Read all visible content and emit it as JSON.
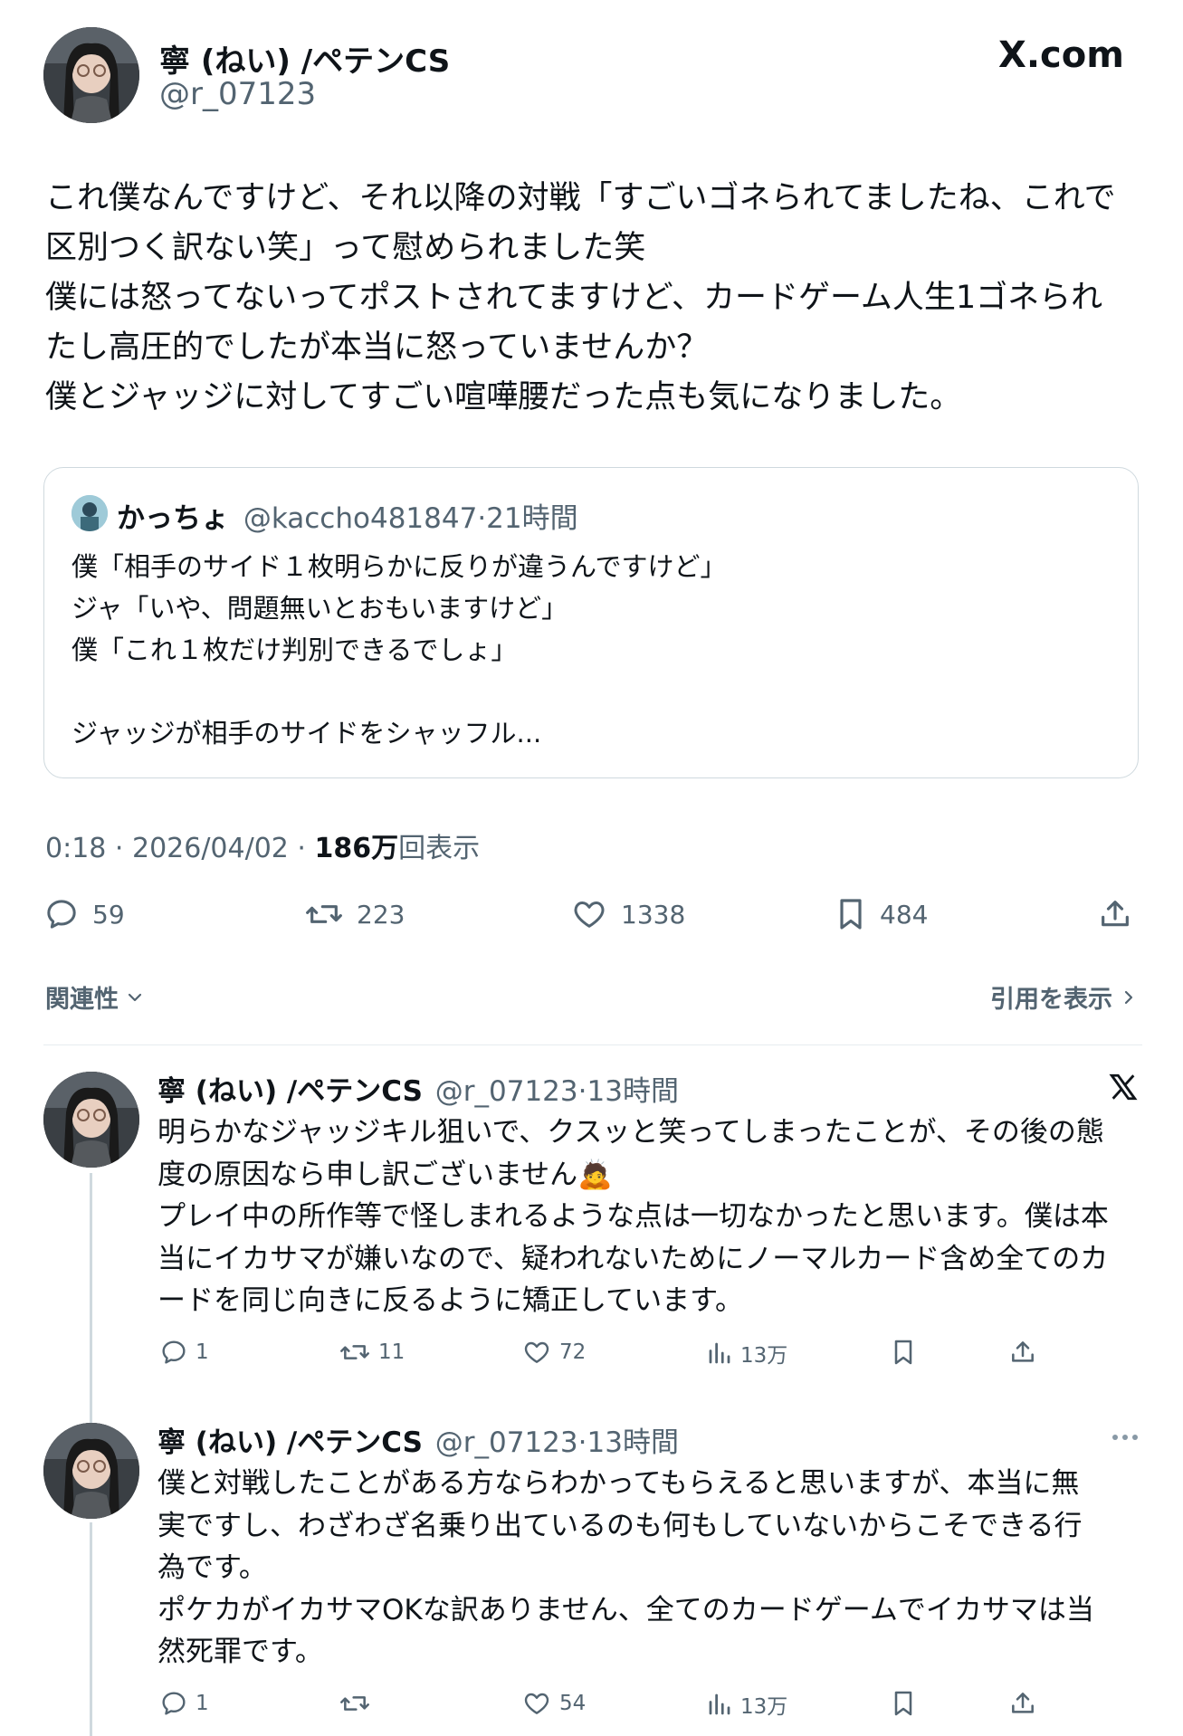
{
  "header": {
    "display_name": "寧 (ねい) /ペテンCS",
    "handle": "@r_07123",
    "site_logo": "X.com"
  },
  "post": {
    "lines": [
      "これ僕なんですけど、それ以降の対戦「すごいゴネられてましたね、これで",
      "区別つく訳ない笑」って慰められました笑",
      "僕には怒ってないってポストされてますけど、カードゲーム人生1ゴネられ",
      "たし高圧的でしたが本当に怒っていませんか？",
      "僕とジャッジに対してすごい喧嘩腰だった点も気になりました。"
    ],
    "quote": {
      "name": "かっちょ",
      "handle": "@kaccho481847",
      "time": "·21時間",
      "lines": [
        "僕「相手のサイド１枚明らかに反りが違うんですけど」",
        "ジャ「いや、問題無いとおもいますけど」",
        "僕「これ１枚だけ判別できるでしょ」",
        "",
        "ジャッジが相手のサイドをシャッフル..."
      ]
    },
    "meta_time": "0:18 · 2026/04/02 · ",
    "views_count": "186万",
    "views_label": "回表示",
    "actions": {
      "replies": "59",
      "reposts": "223",
      "likes": "1338",
      "bookmarks": "484"
    }
  },
  "sort": {
    "label": "関連性",
    "quotes_link": "引用を表示"
  },
  "replies": [
    {
      "name": "寧 (ねい) /ペテンCS",
      "handle": "@r_07123",
      "time": "·13時間",
      "lines": [
        "明らかなジャッジキル狙いで、クスッと笑ってしまったことが、その後の態",
        "度の原因なら申し訳ございません🙇",
        "プレイ中の所作等で怪しまれるような点は一切なかったと思います。僕は本",
        "当にイカサマが嫌いなので、疑われないためにノーマルカード含め全てのカ",
        "ードを同じ向きに反るように矯正しています。"
      ],
      "replies": "1",
      "reposts": "11",
      "likes": "72",
      "views": "13万"
    },
    {
      "name": "寧 (ねい) /ペテンCS",
      "handle": "@r_07123",
      "time": "·13時間",
      "lines": [
        "僕と対戦したことがある方ならわかってもらえると思いますが、本当に無",
        "実ですし、わざわざ名乗り出ているのも何もしていないからこそできる行",
        "為です。",
        "ポケカがイカサマOKな訳ありません、全てのカードゲームでイカサマは当",
        "然死罪です。"
      ],
      "replies": "1",
      "reposts": "",
      "likes": "54",
      "views": "13万"
    }
  ],
  "colors": {
    "text": "#0f1419",
    "secondary": "#536471",
    "border": "#cfd9de"
  }
}
